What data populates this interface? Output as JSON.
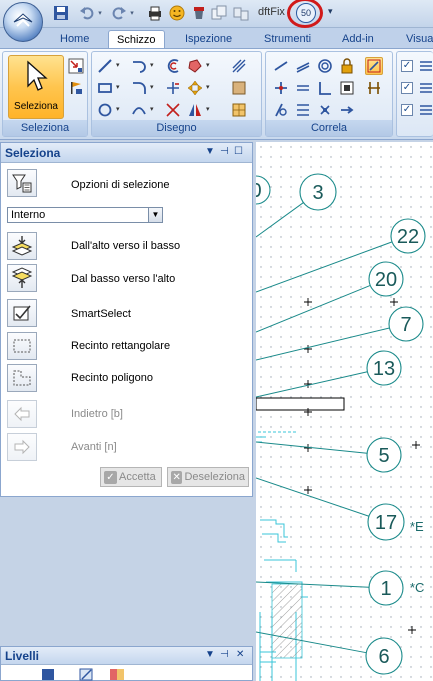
{
  "title_bar": {
    "document_title": "dftFix",
    "zoom_badge": "50"
  },
  "tabs": [
    {
      "label": "Home"
    },
    {
      "label": "Schizzo",
      "active": true
    },
    {
      "label": "Ispezione"
    },
    {
      "label": "Strumenti"
    },
    {
      "label": "Add-in"
    },
    {
      "label": "Visua"
    }
  ],
  "ribbon": {
    "groups": {
      "seleziona": "Seleziona",
      "disegno": "Disegno",
      "correla": "Correla"
    },
    "select_button_label": "Seleziona"
  },
  "selection_panel": {
    "title": "Seleziona",
    "options_label": "Opzioni di selezione",
    "mode_value": "Interno",
    "items": [
      {
        "label": "Dall'alto verso il basso",
        "disabled": false
      },
      {
        "label": "Dal basso verso l'alto",
        "disabled": false
      },
      {
        "label": "SmartSelect",
        "disabled": false
      },
      {
        "label": "Recinto rettangolare",
        "disabled": false
      },
      {
        "label": "Recinto poligono",
        "disabled": false
      },
      {
        "label": "Indietro [b]",
        "disabled": true
      },
      {
        "label": "Avanti [n]",
        "disabled": true
      }
    ],
    "accept_label": "Accetta",
    "deselect_label": "Deseleziona"
  },
  "layers_panel": {
    "title": "Livelli"
  },
  "drawing": {
    "balloons": [
      {
        "label": "3"
      },
      {
        "label": "22"
      },
      {
        "label": "20"
      },
      {
        "label": "7"
      },
      {
        "label": "13"
      },
      {
        "label": "5"
      },
      {
        "label": "17"
      },
      {
        "label": "1"
      },
      {
        "label": "6"
      },
      {
        "label": "0"
      }
    ],
    "side_notes": [
      "*E",
      "*C"
    ],
    "colors": {
      "leader": "#1a8a8a",
      "cyan_detail": "#39c6d8",
      "dots": "#9aa4b0"
    }
  }
}
